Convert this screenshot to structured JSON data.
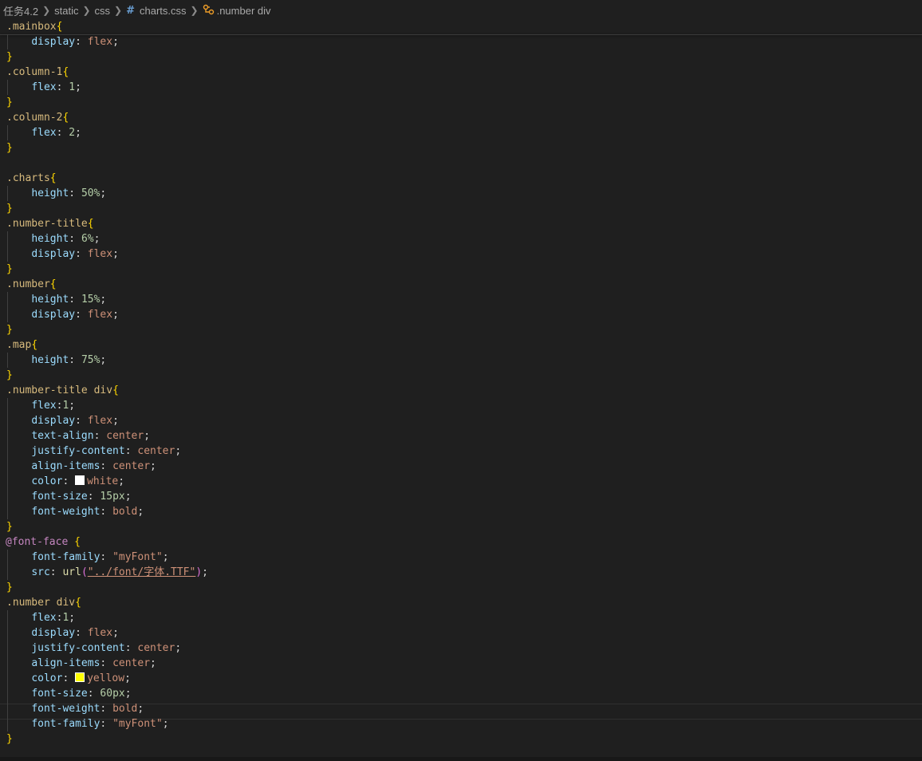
{
  "breadcrumb": {
    "items": [
      "任务4.2",
      "static",
      "css",
      "charts.css",
      ".number div"
    ]
  },
  "swatches": {
    "white": "#ffffff",
    "yellow": "#ffff00"
  },
  "code": {
    "l1": ".mainbox",
    "l2": "display",
    "l2v": "flex",
    "l4": ".column-1",
    "l5": "flex",
    "l5v": "1",
    "l7": ".column-2",
    "l8": "flex",
    "l8v": "2",
    "l11": ".charts",
    "l12": "height",
    "l12v": "50%",
    "l14": ".number-title",
    "l15": "height",
    "l15v": "6%",
    "l16": "display",
    "l16v": "flex",
    "l18": ".number",
    "l19": "height",
    "l19v": "15%",
    "l20": "display",
    "l20v": "flex",
    "l22": ".map",
    "l23": "height",
    "l23v": "75%",
    "l25": ".number-title div",
    "l26": "flex",
    "l26v": "1",
    "l27": "display",
    "l27v": "flex",
    "l28": "text-align",
    "l28v": "center",
    "l29": "justify-content",
    "l29v": "center",
    "l30": "align-items",
    "l30v": "center",
    "l31": "color",
    "l31v": "white",
    "l32": "font-size",
    "l32v": "15px",
    "l33": "font-weight",
    "l33v": "bold",
    "l35": "@font-face",
    "l36": "font-family",
    "l36v": "\"myFont\"",
    "l37": "src",
    "l37fn": "url",
    "l37v": "\"../font/字体.TTF\"",
    "l39": ".number div",
    "l40": "flex",
    "l40v": "1",
    "l41": "display",
    "l41v": "flex",
    "l42": "justify-content",
    "l42v": "center",
    "l43": "align-items",
    "l43v": "center",
    "l44": "color",
    "l44v": "yellow",
    "l45": "font-size",
    "l45v": "60px",
    "l46": "font-weight",
    "l46v": "bold",
    "l47": "font-family",
    "l47v": "\"myFont\""
  }
}
